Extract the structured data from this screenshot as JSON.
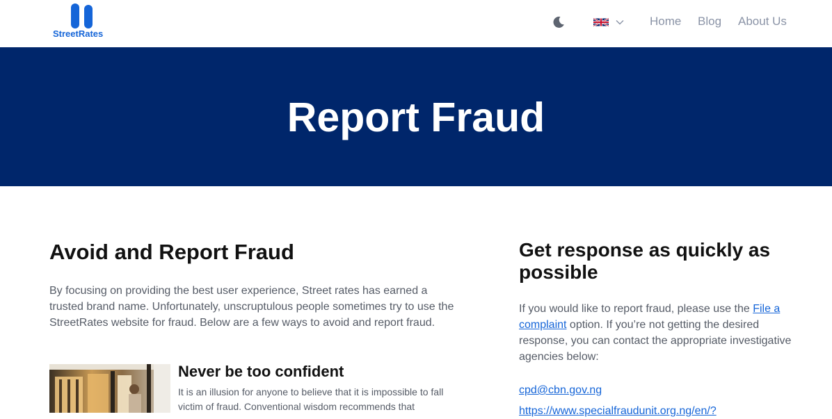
{
  "header": {
    "logo_text": "StreetRates",
    "theme_toggle_icon": "moon-icon",
    "language_flag_icon": "uk-flag-icon",
    "language_chevron_icon": "chevron-down-icon",
    "nav": {
      "home": "Home",
      "blog": "Blog",
      "about": "About Us"
    }
  },
  "hero": {
    "title": "Report Fraud"
  },
  "left": {
    "title": "Avoid and Report Fraud",
    "intro": "By focusing on providing the best user experience, Street rates has earned a trusted brand name. Unfortunately, unscruptulous people sometimes try to use the StreetRates website for fraud. Below are a few ways to avoid and report fraud.",
    "card": {
      "title": "Never be too confident",
      "body": "It is an illusion for anyone to believe that it is impossible to fall victim of fraud. Conventional wisdom recommends that"
    }
  },
  "right": {
    "title": "Get response as quickly as possible",
    "text_before_link": "If you would like to report fraud, please use the ",
    "link": "File a complaint",
    "text_after_link": " option. If you’re not getting the desired response, you can contact the appropriate investigative agencies below:",
    "contacts": [
      "cpd@cbn.gov.ng",
      "https://www.specialfraudunit.org.ng/en/?"
    ]
  },
  "colors": {
    "brand_blue": "#1565d8",
    "hero_bg": "#00266b",
    "nav_text": "#8a93a6",
    "body_text": "#555b66",
    "heading_text": "#111111"
  }
}
